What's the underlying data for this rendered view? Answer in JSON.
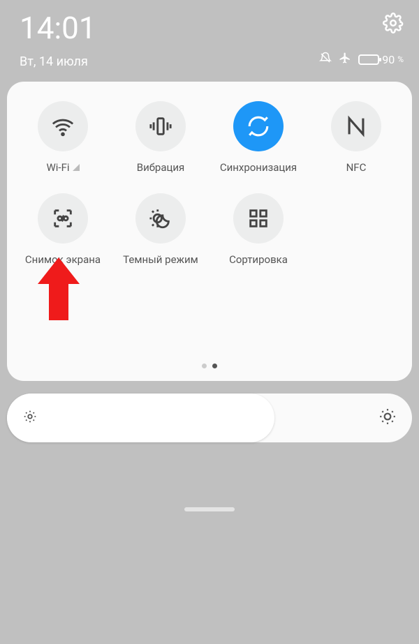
{
  "statusbar": {
    "time": "14:01",
    "date": "Вт, 14 июля",
    "battery_pct": "90",
    "battery_unit": "%"
  },
  "tiles": [
    {
      "label": "Wi-Fi",
      "icon": "wifi",
      "active": false
    },
    {
      "label": "Вибрация",
      "icon": "vibrate",
      "active": false
    },
    {
      "label": "Синхронизация",
      "icon": "sync",
      "active": true
    },
    {
      "label": "NFC",
      "icon": "nfc",
      "active": false
    },
    {
      "label": "Снимок экрана",
      "icon": "screenshot",
      "active": false
    },
    {
      "label": "Темный режим",
      "icon": "dark-mode",
      "active": false
    },
    {
      "label": "Сортировка",
      "icon": "sort",
      "active": false
    }
  ],
  "pager": {
    "count": 2,
    "active_index": 1
  }
}
